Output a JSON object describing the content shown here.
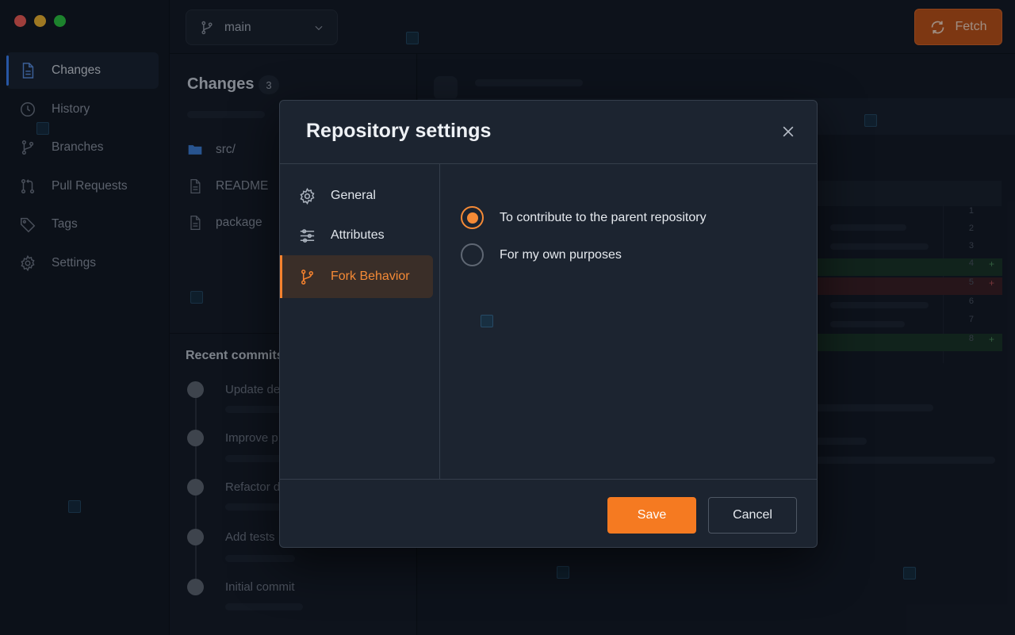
{
  "window": {
    "branch_selector": {
      "value": "main"
    },
    "fetch_button": {
      "label": "Fetch"
    }
  },
  "sidebar": {
    "items": [
      {
        "label": "Changes",
        "icon": "file-icon",
        "active": true
      },
      {
        "label": "History",
        "icon": "clock-icon"
      },
      {
        "label": "Branches",
        "icon": "branch-icon"
      },
      {
        "label": "Pull Requests",
        "icon": "pull-request-icon"
      },
      {
        "label": "Tags",
        "icon": "tag-icon"
      },
      {
        "label": "Settings",
        "icon": "gear-icon"
      }
    ]
  },
  "changes": {
    "title": "Changes",
    "count": "3",
    "files": [
      {
        "name": "src/",
        "icon": "folder-icon"
      },
      {
        "name": "README",
        "icon": "file-icon"
      },
      {
        "name": "package",
        "icon": "file-icon"
      }
    ],
    "recent_title": "Recent commits",
    "commits": [
      "Update de",
      "Improve p",
      "Refactor d",
      "Add tests",
      "Initial commit"
    ]
  },
  "diff": {
    "line_numbers": [
      "1",
      "2",
      "3",
      "4",
      "5",
      "6",
      "7",
      "8"
    ],
    "markers": {
      "add": "+",
      "del": "+"
    }
  },
  "modal": {
    "title": "Repository settings",
    "nav": [
      {
        "label": "General",
        "icon": "gear-icon"
      },
      {
        "label": "Attributes",
        "icon": "sliders-icon"
      },
      {
        "label": "Fork Behavior",
        "icon": "fork-icon",
        "active": true
      }
    ],
    "fork_options": [
      {
        "label": "To contribute to the parent repository",
        "selected": true
      },
      {
        "label": "For my own purposes",
        "selected": false
      }
    ],
    "save_label": "Save",
    "cancel_label": "Cancel"
  },
  "colors": {
    "accent": "#f57a21",
    "sidebar_active": "#3b82f6",
    "fetch_bg": "#bf5216"
  }
}
